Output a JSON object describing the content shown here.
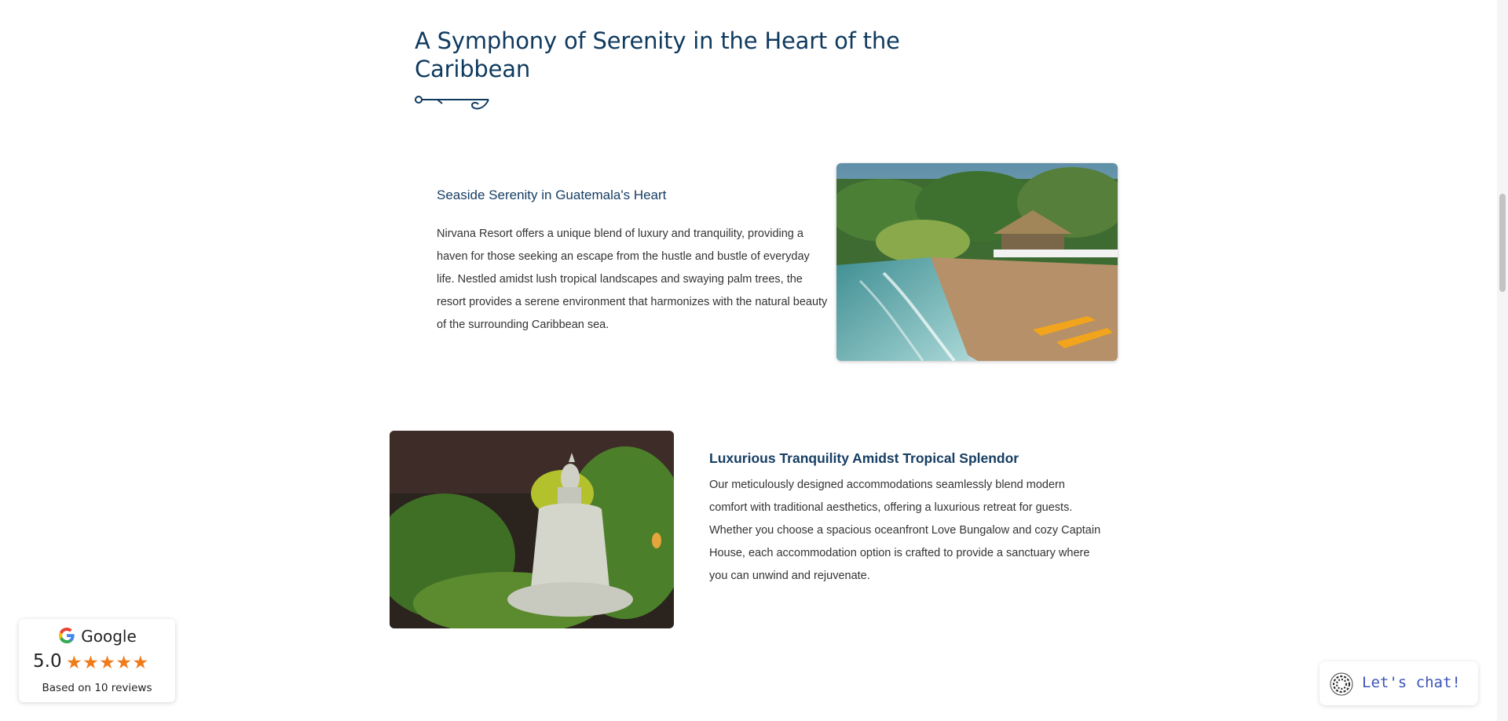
{
  "intro": {
    "title": "A Symphony of Serenity in the Heart of the Caribbean",
    "divider_icon": "anchor-line-icon"
  },
  "section1": {
    "title": "Seaside Serenity in Guatemala's Heart",
    "body": "Nirvana Resort offers a unique blend of luxury and tranquility, providing a haven for those seeking an escape from the hustle and bustle of everyday life. Nestled amidst lush tropical landscapes and swaying palm trees, the resort provides a serene environment that harmonizes with the natural beauty of the surrounding Caribbean sea.",
    "image": "beach-kayaks-photo"
  },
  "section2": {
    "title": "Luxurious Tranquility Amidst Tropical Splendor",
    "body": "Our meticulously designed accommodations seamlessly blend modern comfort with traditional aesthetics, offering a luxurious retreat for guests. Whether you choose a spacious  oceanfront Love Bungalow and cozy Captain House, each accommodation option is crafted to provide a sanctuary where you can unwind and rejuvenate.",
    "image": "buddha-statue-photo"
  },
  "google_badge": {
    "brand": "Google",
    "score": "5.0",
    "stars": 5,
    "reviews_text": "Based on 10 reviews",
    "star_color": "#f07b1b"
  },
  "chat": {
    "label": "Let's chat!",
    "icon": "chat-logo-icon"
  },
  "colors": {
    "heading": "#0f3a5f",
    "body_text": "#333333",
    "chat_text": "#3a55b8"
  }
}
